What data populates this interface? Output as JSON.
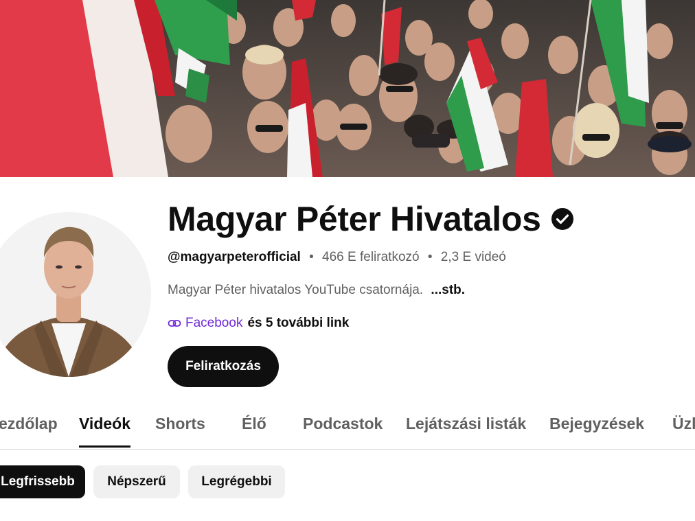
{
  "channel": {
    "name": "Magyar Péter Hivatalos",
    "handle": "@magyarpeterofficial",
    "dot": "•",
    "subscribers": "466 E feliratkozó",
    "videos": "2,3 E videó",
    "description": "Magyar Péter hivatalos YouTube csatornája.",
    "description_more": "...stb.",
    "link_label": "Facebook",
    "more_links": "és 5 további link",
    "subscribe_label": "Feliratkozás"
  },
  "tabs": [
    {
      "label": "ezdőlap"
    },
    {
      "label": "Videók",
      "active": true
    },
    {
      "label": "Shorts"
    },
    {
      "label": "Élő"
    },
    {
      "label": "Podcastok"
    },
    {
      "label": "Lejátszási listák"
    },
    {
      "label": "Bejegyzések"
    },
    {
      "label": "Üzl"
    }
  ],
  "chips": [
    {
      "label": "Legfrissebb",
      "active": true
    },
    {
      "label": "Népszerű"
    },
    {
      "label": "Legrégebbi"
    }
  ],
  "icons": {
    "verified": "verified-check-icon",
    "link": "link-icon"
  },
  "colors": {
    "link": "#6f27d6",
    "primary": "#0f0f0f",
    "secondary": "#606060"
  }
}
